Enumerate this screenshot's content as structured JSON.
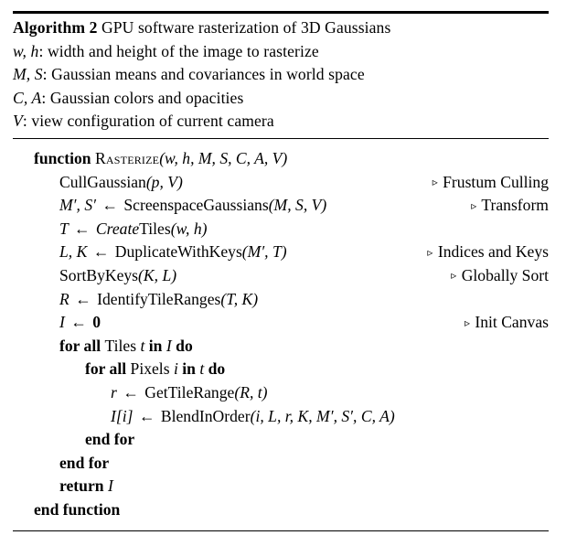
{
  "figure": {
    "title_bold": "Algorithm 2",
    "title_rest": "GPU software rasterization of 3D Gaussians",
    "rules": {
      "top_thick": true,
      "middle": true,
      "bottom": true
    }
  },
  "inputs": [
    {
      "symbols": "w, h",
      "separator": ":",
      "description": "width and height of the image to rasterize"
    },
    {
      "symbols": "M, S",
      "separator": ":",
      "description": "Gaussian means and covariances in world space"
    },
    {
      "symbols": "C, A",
      "separator": ":",
      "description": "Gaussian colors and opacities"
    },
    {
      "symbols": "V",
      "separator": ":",
      "description": "view configuration of current camera"
    }
  ],
  "body": {
    "function_keyword": "function",
    "function_name": "Rasterize",
    "function_args": "(w, h, M, S, C, A, V)",
    "lines": [
      {
        "indent": 1,
        "code": "CullGaussian(p, V)",
        "comment": "Frustum Culling",
        "marker": "▹"
      },
      {
        "indent": 1,
        "code": "M′, S′ ← ScreenspaceGaussians(M, S, V)",
        "comment": "Transform",
        "marker": "▹"
      },
      {
        "indent": 1,
        "code": "T ← CreateTiles(w, h)",
        "comment": "",
        "marker": ""
      },
      {
        "indent": 1,
        "code": "L, K ← DuplicateWithKeys(M′, T)",
        "comment": "Indices and Keys",
        "marker": "▹"
      },
      {
        "indent": 1,
        "code": "SortByKeys(K, L)",
        "comment": "Globally Sort",
        "marker": "▹"
      },
      {
        "indent": 1,
        "code": "R ← IdentifyTileRanges(T, K)",
        "comment": "",
        "marker": ""
      },
      {
        "indent": 1,
        "code": "I ← 0",
        "comment": "Init Canvas",
        "marker": "▹"
      },
      {
        "indent": 1,
        "code": "for all Tiles t in I do",
        "comment": "",
        "marker": ""
      },
      {
        "indent": 2,
        "code": "for all Pixels i in t do",
        "comment": "",
        "marker": ""
      },
      {
        "indent": 3,
        "code": "r ← GetTileRange(R, t)",
        "comment": "",
        "marker": ""
      },
      {
        "indent": 3,
        "code": "I[i] ← BlendInOrder(i, L, r, K, M′, S′, C, A)",
        "comment": "",
        "marker": ""
      },
      {
        "indent": 2,
        "code": "end for",
        "comment": "",
        "marker": ""
      },
      {
        "indent": 1,
        "code": "end for",
        "comment": "",
        "marker": ""
      },
      {
        "indent": 1,
        "code": "return I",
        "comment": "",
        "marker": ""
      },
      {
        "indent": 0,
        "code": "end function",
        "comment": "",
        "marker": ""
      }
    ]
  }
}
